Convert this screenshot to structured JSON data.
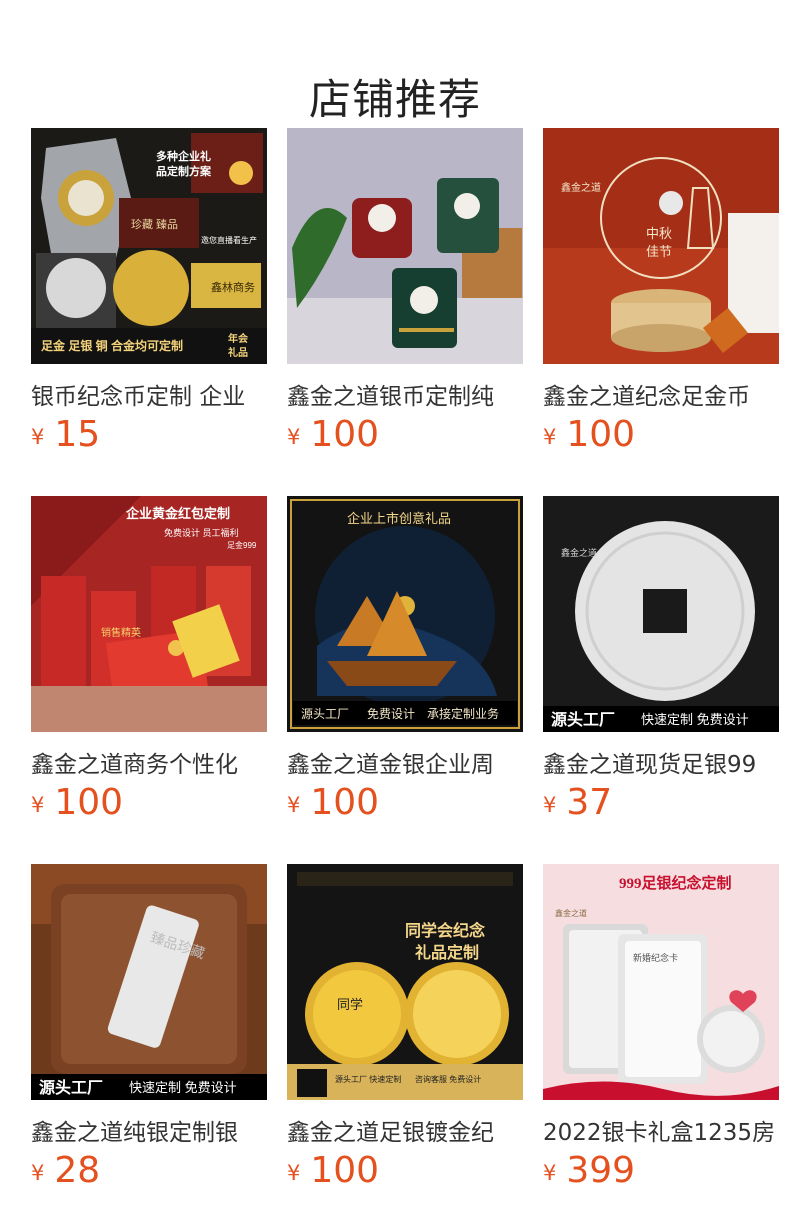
{
  "page": {
    "title": "店铺推荐"
  },
  "currency_symbol": "¥",
  "colors": {
    "price": "#e4501e"
  },
  "products": [
    {
      "name": "银币纪念币定制 企业",
      "price": "15",
      "image": {
        "label": "product-image-medal-crystal",
        "bg": "#1c1a17",
        "texts": [
          "多种企业礼",
          "品定制方案",
          "邀您直播看生产",
          "珍藏",
          "臻品",
          "鑫林商务",
          "足金 足银 铜 合金均可定制",
          "年会",
          "礼品"
        ]
      }
    },
    {
      "name": "鑫金之道银币定制纯",
      "price": "100",
      "image": {
        "label": "product-image-mugs",
        "bg": "#b9b6c7",
        "texts": []
      }
    },
    {
      "name": "鑫金之道纪念足金币",
      "price": "100",
      "image": {
        "label": "product-image-midautumn-coin",
        "bg": "#b83a1c",
        "texts": [
          "鑫金之道",
          "中秋",
          "佳节"
        ]
      }
    },
    {
      "name": "鑫金之道商务个性化",
      "price": "100",
      "image": {
        "label": "product-image-red-envelope",
        "bg": "#a72522",
        "texts": [
          "企业黄金红包定制",
          "免费设计 员工福利",
          "足金999",
          "销售精英"
        ]
      }
    },
    {
      "name": "鑫金之道金银企业周",
      "price": "100",
      "image": {
        "label": "product-image-ship-crystal",
        "bg": "#131313",
        "texts": [
          "企业上市创意礼品",
          "源头工厂",
          "免费设计",
          "承接定制业务"
        ]
      }
    },
    {
      "name": "鑫金之道现货足银99",
      "price": "37",
      "image": {
        "label": "product-image-silver-coin",
        "bg": "#1a1a1a",
        "texts": [
          "鑫金之道",
          "源头工厂",
          "快速定制 免费设计"
        ]
      }
    },
    {
      "name": "鑫金之道纯银定制银",
      "price": "28",
      "image": {
        "label": "product-image-silver-bar",
        "bg": "#6e3a1c",
        "texts": [
          "臻品珍藏",
          "源头工厂",
          "快速定制 免费设计"
        ]
      }
    },
    {
      "name": "鑫金之道足银镀金纪",
      "price": "100",
      "image": {
        "label": "product-image-reunion-coins",
        "bg": "#141414",
        "texts": [
          "同学会纪念",
          "礼品定制",
          "同学",
          "源头工厂 快速定制",
          "咨询客服 免费设计"
        ]
      }
    },
    {
      "name": "2022银卡礼盒1235房",
      "price": "399",
      "image": {
        "label": "product-image-silver-card",
        "bg": "#f6dde0",
        "texts": [
          "999足银纪念定制",
          "新婚纪念卡",
          "鑫金之道"
        ]
      }
    }
  ]
}
